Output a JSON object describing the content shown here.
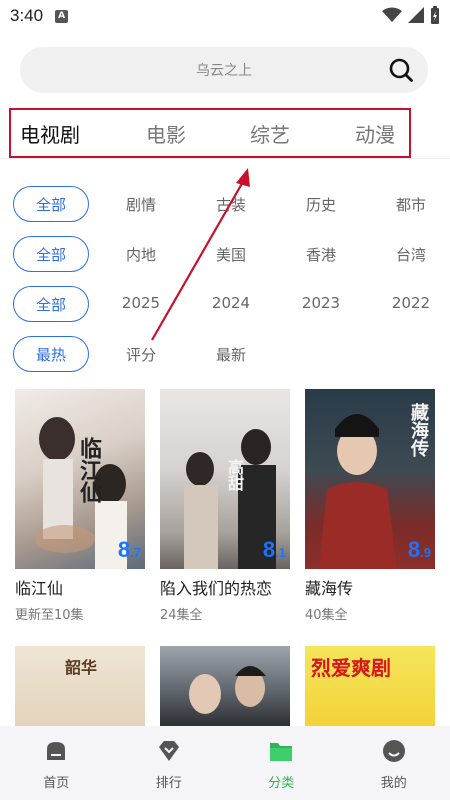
{
  "status": {
    "time": "3:40",
    "notif_letter": "A"
  },
  "search": {
    "placeholder": "乌云之上"
  },
  "top_tabs": [
    {
      "label": "电视剧",
      "active": true
    },
    {
      "label": "电影",
      "active": false
    },
    {
      "label": "综艺",
      "active": false
    },
    {
      "label": "动漫",
      "active": false
    }
  ],
  "filters": {
    "genre": {
      "selected": "全部",
      "options": [
        "剧情",
        "古装",
        "历史",
        "都市"
      ]
    },
    "region": {
      "selected": "全部",
      "options": [
        "内地",
        "美国",
        "香港",
        "台湾"
      ]
    },
    "year": {
      "selected": "全部",
      "options": [
        "2025",
        "2024",
        "2023",
        "2022"
      ]
    },
    "sort": {
      "selected": "最热",
      "options": [
        "评分",
        "最新"
      ]
    }
  },
  "cards": [
    {
      "title": "临江仙",
      "sub": "更新至10集",
      "rating_int": "8",
      "rating_dec": ".7",
      "art": "临江仙"
    },
    {
      "title": "陷入我们的热恋",
      "sub": "24集全",
      "rating_int": "8",
      "rating_dec": ".1",
      "art": "高甜"
    },
    {
      "title": "藏海传",
      "sub": "40集全",
      "rating_int": "8",
      "rating_dec": ".9",
      "art": "藏海传"
    },
    {
      "title": "",
      "sub": "",
      "art": "韶华"
    },
    {
      "title": "",
      "sub": "",
      "art": ""
    },
    {
      "title": "",
      "sub": "",
      "art": "烈爱爽剧"
    }
  ],
  "bottom_nav": [
    {
      "label": "首页",
      "icon": "home-icon",
      "active": false
    },
    {
      "label": "排行",
      "icon": "ranking-icon",
      "active": false
    },
    {
      "label": "分类",
      "icon": "category-folder-icon",
      "active": true
    },
    {
      "label": "我的",
      "icon": "profile-icon",
      "active": false
    }
  ],
  "colors": {
    "accent_blue": "#2f6fe4",
    "active_green": "#2fb35a",
    "annotation_red": "#c8102e",
    "rating_blue": "#1a73ff"
  }
}
